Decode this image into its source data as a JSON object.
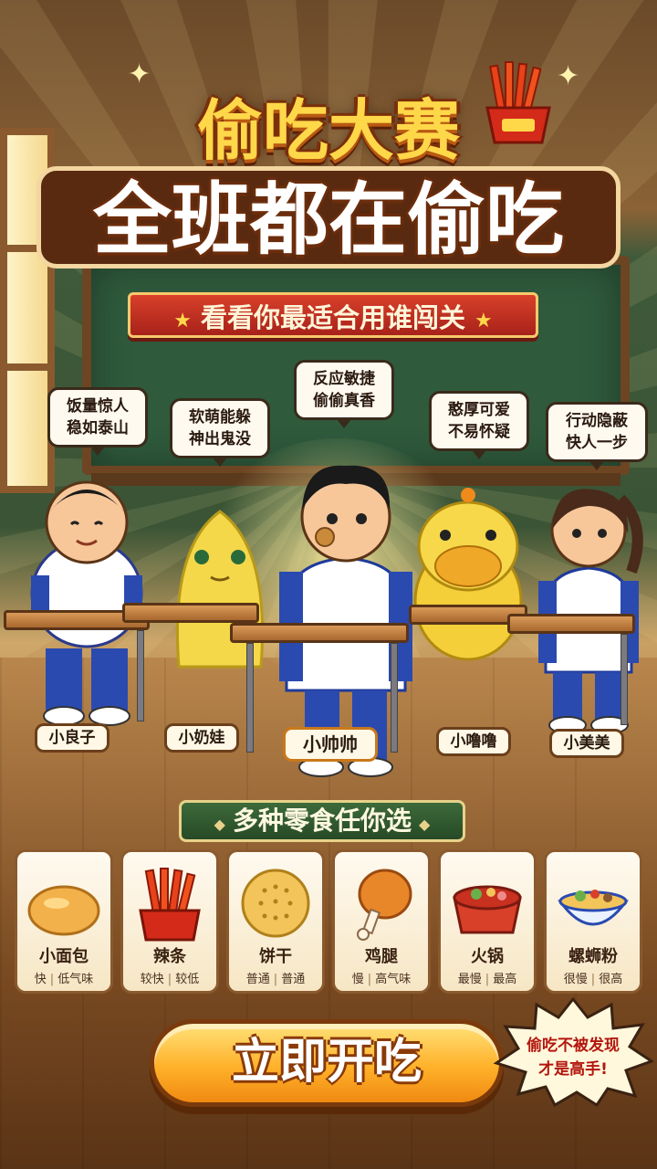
{
  "title": {
    "main": "偷吃大赛",
    "sub": "全班都在偷吃",
    "ribbon": "看看你最适合用谁闯关"
  },
  "characters": [
    {
      "name": "小良子",
      "bubble_line1": "饭量惊人",
      "bubble_line2": "稳如泰山"
    },
    {
      "name": "小奶娃",
      "bubble_line1": "软萌能躲",
      "bubble_line2": "神出鬼没"
    },
    {
      "name": "小帅帅",
      "bubble_line1": "反应敏捷",
      "bubble_line2": "偷偷真香"
    },
    {
      "name": "小噜噜",
      "bubble_line1": "憨厚可爱",
      "bubble_line2": "不易怀疑"
    },
    {
      "name": "小美美",
      "bubble_line1": "行动隐蔽",
      "bubble_line2": "快人一步"
    }
  ],
  "snack_section": {
    "title": "多种零食任你选",
    "snacks": [
      {
        "name": "小面包",
        "speed": "快",
        "smell": "低气味",
        "icon": "bread-icon"
      },
      {
        "name": "辣条",
        "speed": "较快",
        "smell": "较低",
        "icon": "spicy-strip-icon"
      },
      {
        "name": "饼干",
        "speed": "普通",
        "smell": "普通",
        "icon": "cookie-icon"
      },
      {
        "name": "鸡腿",
        "speed": "慢",
        "smell": "高气味",
        "icon": "drumstick-icon"
      },
      {
        "name": "火锅",
        "speed": "最慢",
        "smell": "最高",
        "icon": "hotpot-icon"
      },
      {
        "name": "螺蛳粉",
        "speed": "很慢",
        "smell": "很高",
        "icon": "noodle-bowl-icon"
      }
    ]
  },
  "start_button": {
    "label": "立即开吃"
  },
  "tip": {
    "line1": "偷吃不被发现",
    "line2": "才是高手!"
  },
  "colors": {
    "accent": "#ffb12a",
    "title": "#ffd84a",
    "ribbon": "#c8301f",
    "board": "#2f5a3c"
  }
}
